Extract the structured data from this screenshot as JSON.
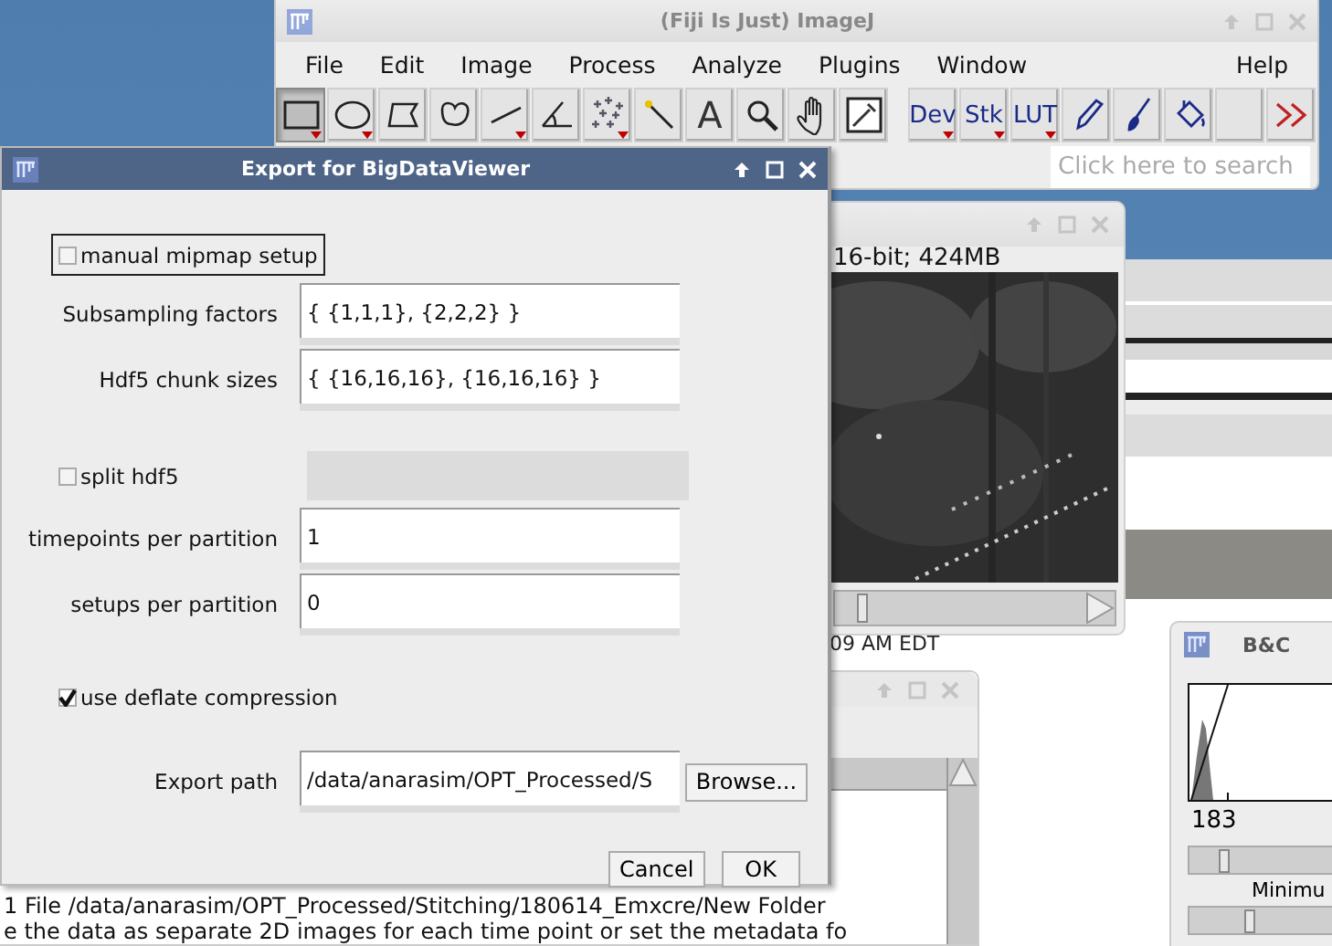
{
  "imagej": {
    "title": "(Fiji Is Just) ImageJ",
    "menus": [
      "File",
      "Edit",
      "Image",
      "Process",
      "Analyze",
      "Plugins",
      "Window",
      "Help"
    ],
    "tools": [
      {
        "kind": "rectangle",
        "selected": true,
        "submenu": true
      },
      {
        "kind": "oval",
        "selected": false,
        "submenu": true
      },
      {
        "kind": "polygon",
        "selected": false,
        "submenu": false
      },
      {
        "kind": "freehand",
        "selected": false,
        "submenu": false
      },
      {
        "kind": "line",
        "selected": false,
        "submenu": true
      },
      {
        "kind": "angle",
        "selected": false,
        "submenu": false
      },
      {
        "kind": "multipoint",
        "selected": false,
        "submenu": true
      },
      {
        "kind": "wand",
        "selected": false,
        "submenu": false
      },
      {
        "kind": "text",
        "label": "A",
        "selected": false,
        "submenu": false
      },
      {
        "kind": "magnifier",
        "selected": false,
        "submenu": false
      },
      {
        "kind": "hand",
        "selected": false,
        "submenu": false
      },
      {
        "kind": "dropper",
        "selected": false,
        "submenu": false
      },
      {
        "kind": "menu",
        "label": "Dev",
        "selected": false,
        "submenu": true
      },
      {
        "kind": "menu",
        "label": "Stk",
        "selected": false,
        "submenu": true
      },
      {
        "kind": "menu",
        "label": "LUT",
        "selected": false,
        "submenu": true
      },
      {
        "kind": "pencil",
        "selected": false,
        "submenu": false
      },
      {
        "kind": "brush",
        "selected": false,
        "submenu": false
      },
      {
        "kind": "fill",
        "selected": false,
        "submenu": false
      },
      {
        "kind": "blank",
        "selected": false,
        "submenu": false
      },
      {
        "kind": "more",
        "selected": false,
        "submenu": false
      }
    ],
    "search": {
      "placeholder": "Click here to search"
    }
  },
  "background_window": {
    "log_time": "09 AM EDT"
  },
  "image_window": {
    "subtitle": "16-bit; 424MB",
    "slider": {
      "level": 0.08
    }
  },
  "log_window": {
    "lines": [
      "1 File /data/anarasim/OPT_Processed/Stitching/180614_Emxcre/New Folder",
      "e the data as separate 2D images for each time point or set the metadata fo"
    ]
  },
  "bc_window": {
    "title": "B&C",
    "value": "183",
    "slider_label": "Minimu",
    "sliders": [
      {
        "level": 0.2
      },
      {
        "level": 0.38
      }
    ]
  },
  "dialog": {
    "title": "Export for BigDataViewer",
    "rows": [
      {
        "kind": "checkbox",
        "label": "manual mipmap setup",
        "checked": false,
        "focused": true,
        "side_panel": false
      },
      {
        "kind": "field",
        "label": "Subsampling factors",
        "value": "{ {1,1,1}, {2,2,2} }"
      },
      {
        "kind": "field",
        "label": "Hdf5 chunk sizes",
        "value": "{ {16,16,16}, {16,16,16} }"
      },
      {
        "kind": "checkbox",
        "label": "split hdf5",
        "checked": false,
        "focused": false,
        "side_panel": true
      },
      {
        "kind": "field",
        "label": "timepoints per partition",
        "value": "1"
      },
      {
        "kind": "field",
        "label": "setups per partition",
        "value": "0"
      },
      {
        "kind": "checkbox",
        "label": "use deflate compression",
        "checked": true,
        "focused": false,
        "side_panel": false
      },
      {
        "kind": "path",
        "label": "Export path",
        "value": "/data/anarasim/OPT_Processed/S",
        "button": "Browse..."
      }
    ],
    "buttons": [
      "Cancel",
      "OK"
    ]
  }
}
